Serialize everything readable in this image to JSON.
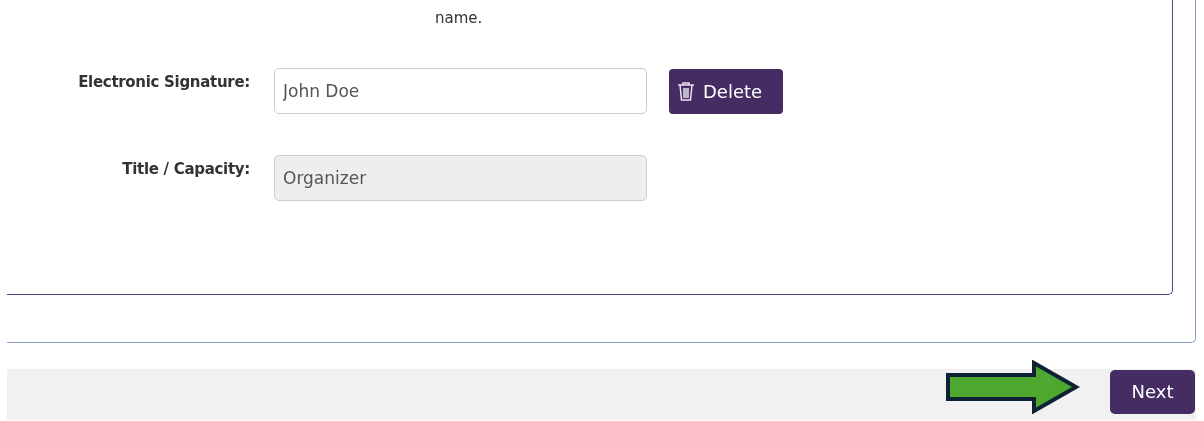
{
  "intro_text": "name.",
  "fields": [
    {
      "label": "Electronic Signature:",
      "value": "John Doe",
      "disabled": false,
      "action": "Delete"
    },
    {
      "label": "Title / Capacity:",
      "value": "Organizer",
      "disabled": true
    }
  ],
  "footer": {
    "next_button": "Next"
  }
}
